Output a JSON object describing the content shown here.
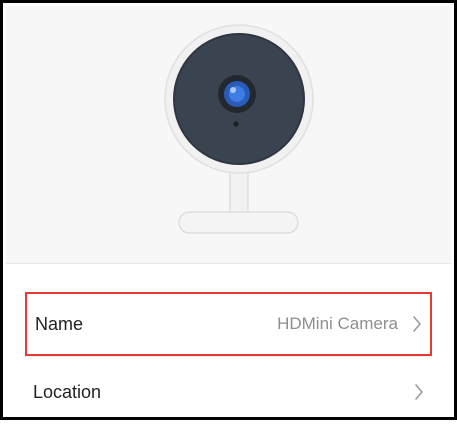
{
  "device": {
    "image_icon": "camera-device-illustration"
  },
  "settings": {
    "rows": [
      {
        "label": "Name",
        "value": "HDMini Camera",
        "icon": "chevron-right-icon",
        "highlighted": true
      },
      {
        "label": "Location",
        "value": "",
        "icon": "chevron-right-icon",
        "highlighted": false
      }
    ]
  },
  "colors": {
    "highlight": "#e53935",
    "value_text": "#8f8f8f",
    "label_text": "#222222"
  }
}
